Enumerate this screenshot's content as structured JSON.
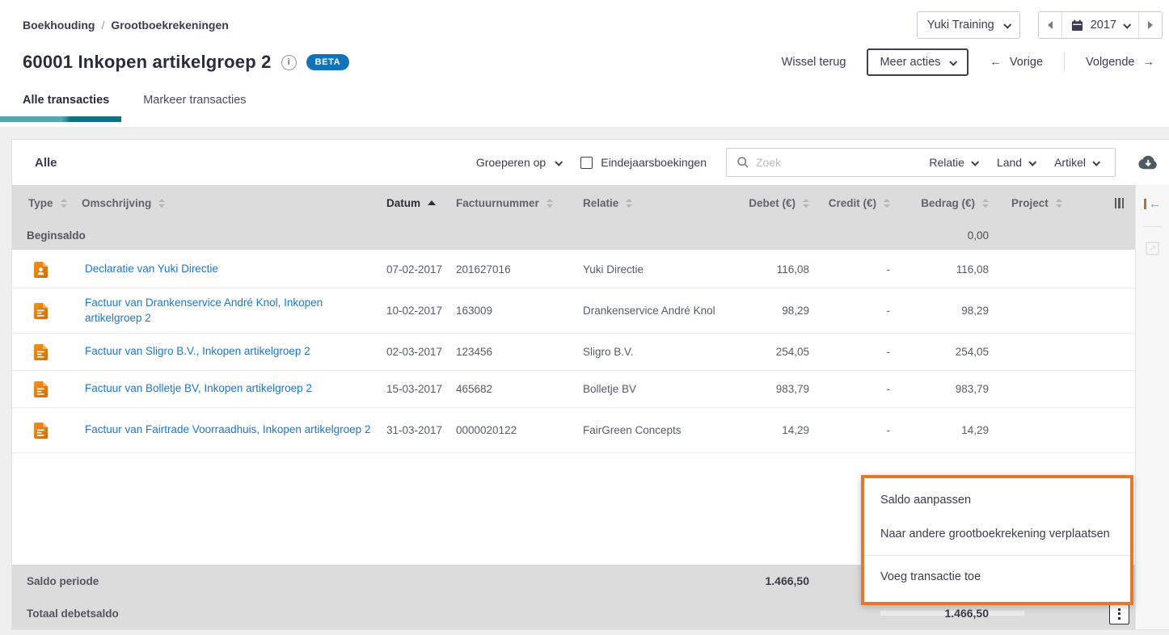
{
  "breadcrumb": {
    "part1": "Boekhouding",
    "separator": "/",
    "part2": "Grootboekrekeningen"
  },
  "topbar": {
    "administration": "Yuki Training",
    "year": "2017",
    "calendar_icon": "calendar",
    "prev_year_icon": "left-triangle",
    "next_year_icon": "right-triangle"
  },
  "header": {
    "title": "60001 Inkopen artikelgroep 2",
    "beta": "BETA",
    "info_icon": "i",
    "wissel_terug": "Wissel terug",
    "meer_acties": "Meer acties",
    "vorige_arrow": "←",
    "vorige": "Vorige",
    "volgende": "Volgende",
    "volgende_arrow": "→"
  },
  "tabs": [
    {
      "label": "Alle transacties",
      "active": true
    },
    {
      "label": "Markeer transacties",
      "active": false
    }
  ],
  "filterbar": {
    "alle": "Alle",
    "groeperen_op": "Groeperen op",
    "eindejaarsboekingen": "Eindejaarsboekingen",
    "search_placeholder": "Zoek",
    "relatie": "Relatie",
    "land": "Land",
    "artikel": "Artikel",
    "download_icon": "cloud-download"
  },
  "table": {
    "headers": {
      "type": "Type",
      "omschrijving": "Omschrijving",
      "datum": "Datum",
      "factuurnummer": "Factuurnummer",
      "relatie": "Relatie",
      "debet": "Debet (€)",
      "credit": "Credit (€)",
      "bedrag": "Bedrag (€)",
      "project": "Project"
    },
    "sorted_by": "Datum ascending",
    "beginsaldo": {
      "label": "Beginsaldo",
      "bedrag": "0,00"
    },
    "rows": [
      {
        "type_icon": "declaration-document",
        "description": "Declaratie van Yuki Directie",
        "datum": "07-02-2017",
        "factuurnummer": "201627016",
        "relatie": "Yuki Directie",
        "debet": "116,08",
        "credit": "-",
        "bedrag": "116,08",
        "project": ""
      },
      {
        "type_icon": "invoice-document",
        "description": "Factuur van Drankenservice André Knol, Inkopen artikelgroep 2",
        "datum": "10-02-2017",
        "factuurnummer": "163009",
        "relatie": "Drankenservice André Knol",
        "debet": "98,29",
        "credit": "-",
        "bedrag": "98,29",
        "project": ""
      },
      {
        "type_icon": "invoice-document",
        "description": "Factuur van Sligro B.V., Inkopen artikelgroep 2",
        "datum": "02-03-2017",
        "factuurnummer": "123456",
        "relatie": "Sligro B.V.",
        "debet": "254,05",
        "credit": "-",
        "bedrag": "254,05",
        "project": ""
      },
      {
        "type_icon": "invoice-document",
        "description": "Factuur van Bolletje BV, Inkopen artikelgroep 2",
        "datum": "15-03-2017",
        "factuurnummer": "465682",
        "relatie": "Bolletje BV",
        "debet": "983,79",
        "credit": "-",
        "bedrag": "983,79",
        "project": ""
      },
      {
        "type_icon": "invoice-document",
        "description": "Factuur van Fairtrade Voorraadhuis, Inkopen artikelgroep 2",
        "datum": "31-03-2017",
        "factuurnummer": "0000020122",
        "relatie": "FairGreen Concepts",
        "debet": "14,29",
        "credit": "-",
        "bedrag": "14,29",
        "project": ""
      }
    ],
    "footer": {
      "saldo_periode_label": "Saldo periode",
      "saldo_periode_debet": "1.466,50",
      "totaal_debetsaldo_label": "Totaal debetsaldo",
      "totaal_debetsaldo_bedrag": "1.466,50"
    }
  },
  "context_menu": {
    "items": [
      "Saldo aanpassen",
      "Naar andere grootboekrekening verplaatsen",
      "Voeg transactie toe"
    ],
    "border_color": "#e8762c"
  },
  "colors": {
    "teal_light": "#55a6af",
    "teal_dark": "#0f7181",
    "link_blue": "#2076c8",
    "badge_blue": "#1274b8",
    "doc_icon_orange": "#e0820f",
    "menu_border_orange": "#e8762c"
  }
}
